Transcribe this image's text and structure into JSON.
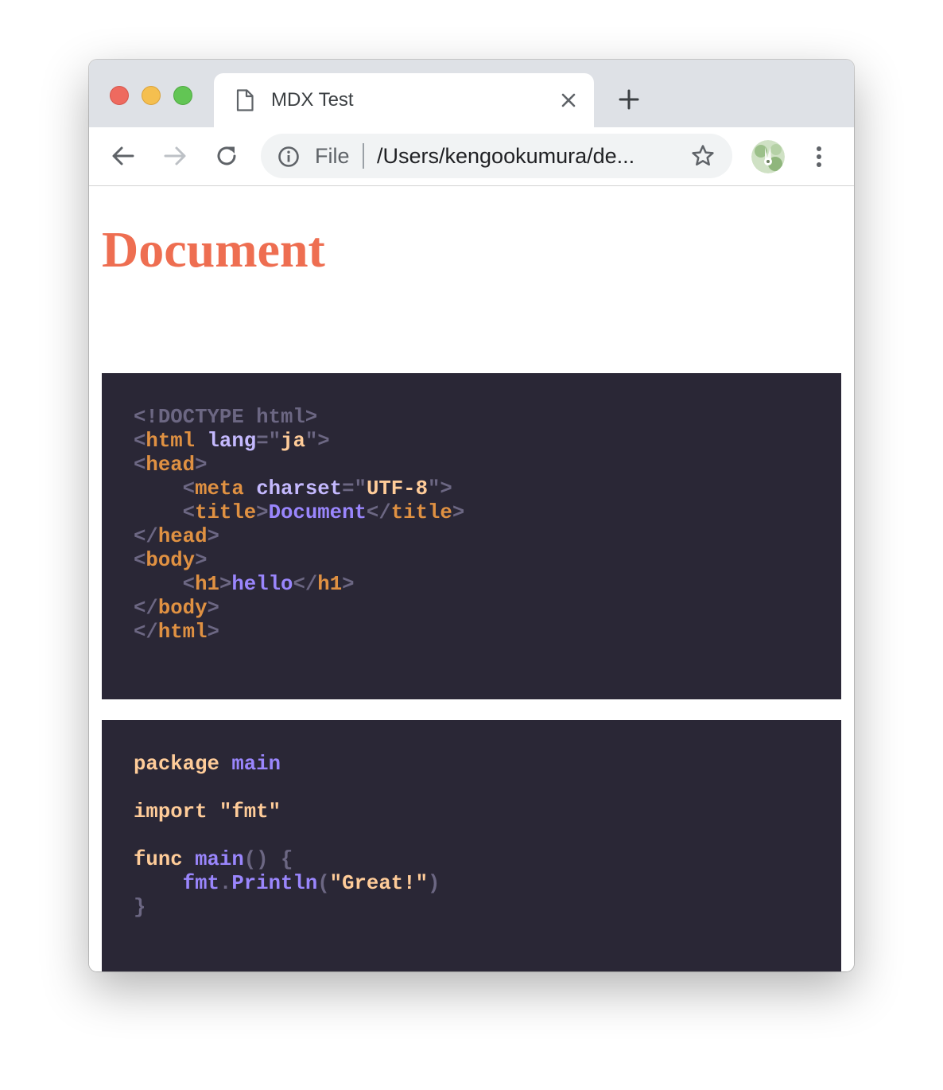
{
  "window": {
    "controls": [
      "close",
      "minimize",
      "zoom"
    ]
  },
  "tab": {
    "title": "MDX Test",
    "icon": "page-icon",
    "close_icon": "close-icon"
  },
  "new_tab_icon": "plus-icon",
  "toolbar": {
    "back_icon": "back-arrow-icon",
    "forward_icon": "forward-arrow-icon",
    "reload_icon": "reload-icon",
    "menu_icon": "kebab-menu-icon"
  },
  "omnibox": {
    "chip_label": "File",
    "url": "/Users/kengookumura/de...",
    "info_icon": "info-icon",
    "bookmark_icon": "star-icon"
  },
  "page": {
    "title": "Document",
    "code_blocks": [
      {
        "language": "html",
        "lines": [
          [
            {
              "t": "<!DOCTYPE html>",
              "c": "doctype"
            }
          ],
          [
            {
              "t": "<",
              "c": "punct"
            },
            {
              "t": "html",
              "c": "tag"
            },
            {
              "t": " ",
              "c": "plain"
            },
            {
              "t": "lang",
              "c": "attr"
            },
            {
              "t": "=\"",
              "c": "punct"
            },
            {
              "t": "ja",
              "c": "str"
            },
            {
              "t": "\">",
              "c": "punct"
            }
          ],
          [
            {
              "t": "<",
              "c": "punct"
            },
            {
              "t": "head",
              "c": "tag"
            },
            {
              "t": ">",
              "c": "punct"
            }
          ],
          [
            {
              "t": "    ",
              "c": "plain"
            },
            {
              "t": "<",
              "c": "punct"
            },
            {
              "t": "meta",
              "c": "tag"
            },
            {
              "t": " ",
              "c": "plain"
            },
            {
              "t": "charset",
              "c": "attr"
            },
            {
              "t": "=\"",
              "c": "punct"
            },
            {
              "t": "UTF-8",
              "c": "str"
            },
            {
              "t": "\">",
              "c": "punct"
            }
          ],
          [
            {
              "t": "    ",
              "c": "plain"
            },
            {
              "t": "<",
              "c": "punct"
            },
            {
              "t": "title",
              "c": "tag"
            },
            {
              "t": ">",
              "c": "punct"
            },
            {
              "t": "Document",
              "c": "text"
            },
            {
              "t": "</",
              "c": "punct"
            },
            {
              "t": "title",
              "c": "tag"
            },
            {
              "t": ">",
              "c": "punct"
            }
          ],
          [
            {
              "t": "</",
              "c": "punct"
            },
            {
              "t": "head",
              "c": "tag"
            },
            {
              "t": ">",
              "c": "punct"
            }
          ],
          [
            {
              "t": "<",
              "c": "punct"
            },
            {
              "t": "body",
              "c": "tag"
            },
            {
              "t": ">",
              "c": "punct"
            }
          ],
          [
            {
              "t": "    ",
              "c": "plain"
            },
            {
              "t": "<",
              "c": "punct"
            },
            {
              "t": "h1",
              "c": "tag"
            },
            {
              "t": ">",
              "c": "punct"
            },
            {
              "t": "hello",
              "c": "text"
            },
            {
              "t": "</",
              "c": "punct"
            },
            {
              "t": "h1",
              "c": "tag"
            },
            {
              "t": ">",
              "c": "punct"
            }
          ],
          [
            {
              "t": "</",
              "c": "punct"
            },
            {
              "t": "body",
              "c": "tag"
            },
            {
              "t": ">",
              "c": "punct"
            }
          ],
          [
            {
              "t": "</",
              "c": "punct"
            },
            {
              "t": "html",
              "c": "tag"
            },
            {
              "t": ">",
              "c": "punct"
            }
          ]
        ]
      },
      {
        "language": "go",
        "lines": [
          [
            {
              "t": "package",
              "c": "kw"
            },
            {
              "t": " ",
              "c": "plain"
            },
            {
              "t": "main",
              "c": "fn"
            }
          ],
          [],
          [
            {
              "t": "import",
              "c": "kw"
            },
            {
              "t": " ",
              "c": "plain"
            },
            {
              "t": "\"fmt\"",
              "c": "str"
            }
          ],
          [],
          [
            {
              "t": "func",
              "c": "kw"
            },
            {
              "t": " ",
              "c": "plain"
            },
            {
              "t": "main",
              "c": "fn"
            },
            {
              "t": "() {",
              "c": "punct"
            }
          ],
          [
            {
              "t": "    ",
              "c": "plain"
            },
            {
              "t": "fmt",
              "c": "fn"
            },
            {
              "t": ".",
              "c": "punct"
            },
            {
              "t": "Println",
              "c": "fn"
            },
            {
              "t": "(",
              "c": "punct"
            },
            {
              "t": "\"Great!\"",
              "c": "str"
            },
            {
              "t": ")",
              "c": "punct"
            }
          ],
          [
            {
              "t": "}",
              "c": "punct"
            }
          ]
        ]
      }
    ]
  },
  "colors": {
    "title": "#ee6e51",
    "code_background": "#2a2736",
    "tab_strip": "#dee1e6",
    "omnibox": "#f1f3f4"
  }
}
